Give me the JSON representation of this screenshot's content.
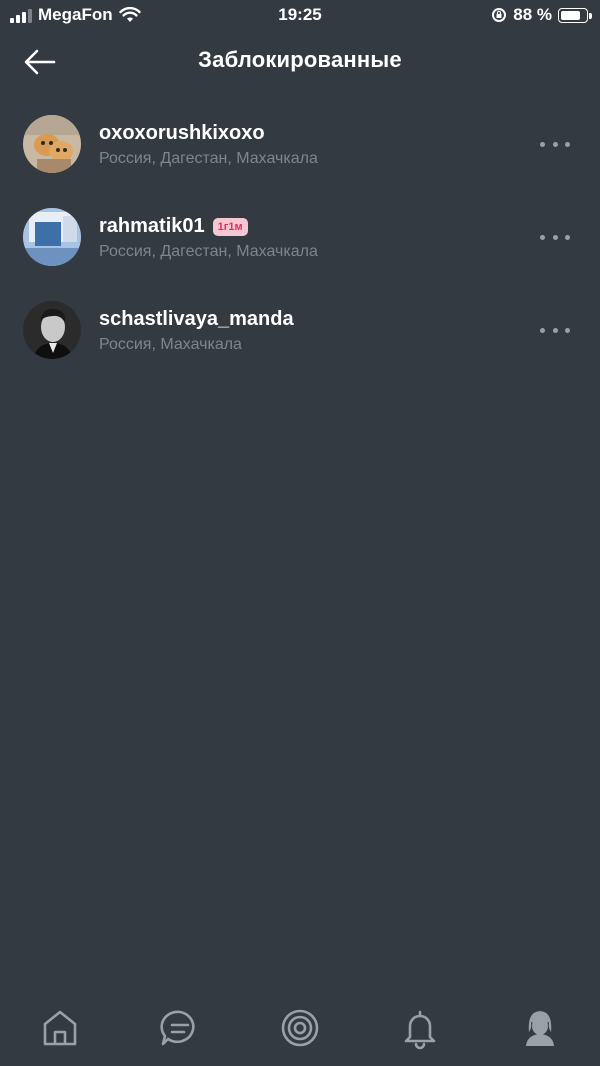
{
  "status_bar": {
    "carrier": "MegaFon",
    "time": "19:25",
    "battery_text": "88 %",
    "battery_level": 0.88
  },
  "header": {
    "title": "Заблокированные",
    "back_icon": "arrow-left-icon"
  },
  "blocked_users": [
    {
      "username": "oxoxorushkixoxo",
      "location": "Россия, Дагестан, Махачкала",
      "badge": ""
    },
    {
      "username": "rahmatik01",
      "location": "Россия, Дагестан, Махачкала",
      "badge": "1г1м"
    },
    {
      "username": "schastlivaya_manda",
      "location": "Россия, Махачкала",
      "badge": ""
    }
  ],
  "tabbar": {
    "items": [
      "home-icon",
      "chat-icon",
      "target-icon",
      "bell-icon",
      "profile-icon"
    ],
    "active": "profile-icon"
  },
  "colors": {
    "background": "#343a42",
    "secondary_text": "#7f858d",
    "badge_text": "#e0335a",
    "badge_bg": "#f6c7d2",
    "icon": "#9aa0a8"
  }
}
